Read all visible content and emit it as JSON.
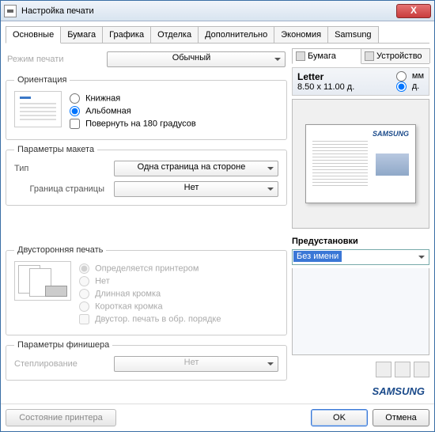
{
  "window": {
    "title": "Настройка печати",
    "close": "X"
  },
  "tabs": [
    "Основные",
    "Бумага",
    "Графика",
    "Отделка",
    "Дополнительно",
    "Экономия",
    "Samsung"
  ],
  "active_tab_index": 0,
  "print_mode": {
    "label": "Режим печати",
    "value": "Обычный"
  },
  "orientation": {
    "legend": "Ориентация",
    "portrait": "Книжная",
    "landscape": "Альбомная",
    "rotate": "Повернуть на 180 градусов",
    "selected": "landscape",
    "rotate_checked": false
  },
  "layout": {
    "legend": "Параметры макета",
    "type_label": "Тип",
    "type_value": "Одна страница на стороне",
    "border_label": "Граница страницы",
    "border_value": "Нет"
  },
  "duplex": {
    "legend": "Двусторонняя печать",
    "auto": "Определяется принтером",
    "none": "Нет",
    "long": "Длинная кромка",
    "short": "Короткая кромка",
    "reverse": "Двустор. печать в обр. порядке",
    "selected": "auto",
    "enabled": false
  },
  "finisher": {
    "legend": "Параметры финишера",
    "staple_label": "Степлирование",
    "staple_value": "Нет",
    "enabled": false
  },
  "right": {
    "tab_paper": "Бумага",
    "tab_device": "Устройство",
    "paper_name": "Letter",
    "paper_dims": "8.50 x 11.00 д.",
    "unit_mm": "мм",
    "unit_in": "д.",
    "unit_selected": "in",
    "presets_label": "Предустановки",
    "preset_value": "Без имени",
    "brand": "SAMSUNG"
  },
  "footer": {
    "status": "Состояние принтера",
    "ok": "OK",
    "cancel": "Отмена"
  }
}
